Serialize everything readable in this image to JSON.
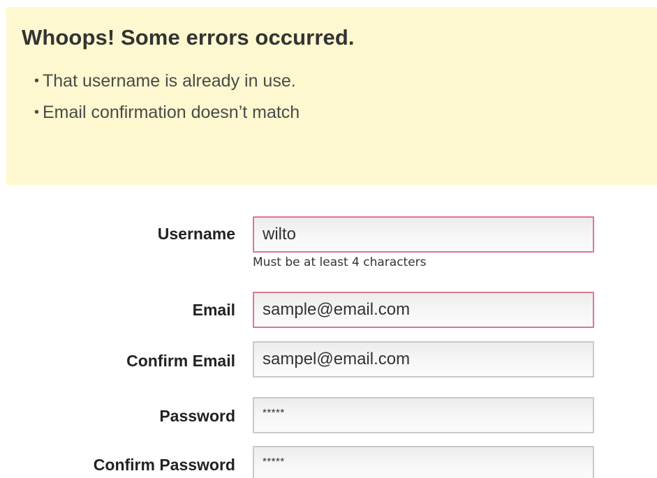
{
  "errors": {
    "title": "Whoops! Some errors occurred.",
    "bullet": "•",
    "items": [
      "That username is already in use.",
      "Email confirmation doesn’t match"
    ]
  },
  "form": {
    "username": {
      "label": "Username",
      "value": "wilto",
      "hint": "Must be at least 4 characters",
      "state": "error"
    },
    "email": {
      "label": "Email",
      "value": "sample@email.com",
      "state": "error"
    },
    "confirm_email": {
      "label": "Confirm Email",
      "value": "sampel@email.com",
      "state": "normal"
    },
    "password": {
      "label": "Password",
      "value": "*****",
      "state": "normal"
    },
    "confirm_password": {
      "label": "Confirm Password",
      "value": "*****",
      "state": "normal"
    }
  },
  "colors": {
    "error_panel_bg": "#fdf8cf",
    "error_border": "#d97a8c",
    "input_border": "#c9c9c9"
  }
}
